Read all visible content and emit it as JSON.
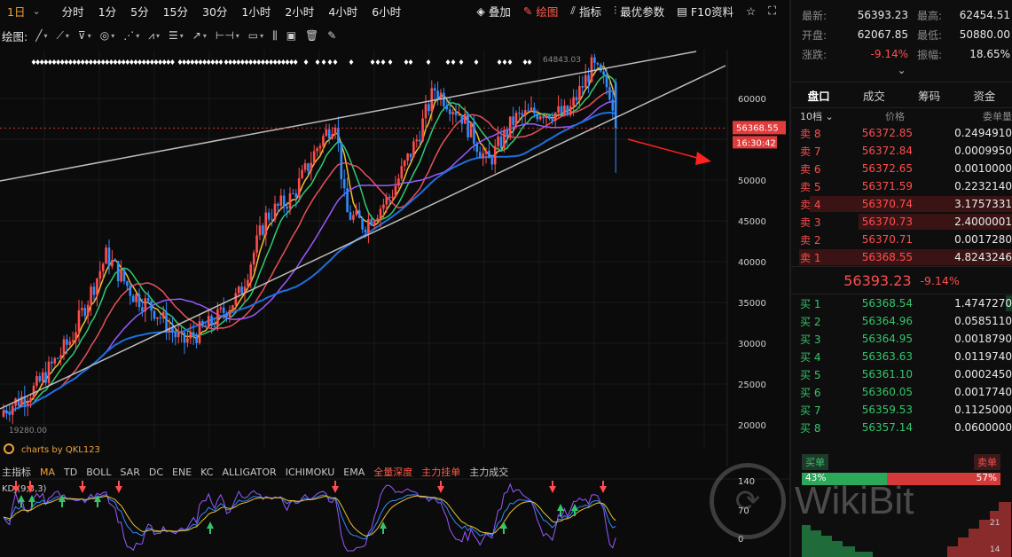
{
  "toolbar": {
    "timeframes": [
      "1日",
      "分时",
      "1分",
      "5分",
      "15分",
      "30分",
      "1小时",
      "2小时",
      "4小时",
      "6小时"
    ],
    "active_timeframe": "1日",
    "tools": [
      {
        "label": "叠加",
        "icon": "layers-icon"
      },
      {
        "label": "绘图",
        "icon": "pencil-icon",
        "active": true
      },
      {
        "label": "指标",
        "icon": "indicator-icon"
      },
      {
        "label": "最优参数",
        "icon": "sliders-icon"
      },
      {
        "label": "F10资料",
        "icon": "f10-icon"
      }
    ]
  },
  "drawbar": {
    "label": "绘图:"
  },
  "chart": {
    "price_ticks": [
      "60000",
      "55000",
      "50000",
      "45000",
      "40000",
      "35000",
      "30000",
      "25000",
      "20000"
    ],
    "current_price_tag": "56368.55",
    "countdown_tag": "16:30:42",
    "high_label": "64843.03",
    "low_label": "19280.00",
    "credit": "charts by QKL123",
    "colors": {
      "up": "#ff4d4d",
      "down": "#2f8cff",
      "ma1": "#f0c030",
      "ma2": "#2ecc71",
      "ma3": "#e8505b",
      "ma4": "#9b59ff",
      "ma5": "#1e6fe0",
      "channel": "#bdbdbd",
      "annotation": "#ff2020"
    }
  },
  "indicator_bar": {
    "items": [
      "主指标",
      "MA",
      "TD",
      "BOLL",
      "SAR",
      "DC",
      "ENE",
      "KC",
      "ALLIGATOR",
      "ICHIMOKU",
      "EMA",
      "全量深度",
      "主力挂单",
      "主力成交"
    ],
    "active": "MA",
    "red_items": [
      "全量深度",
      "主力挂单"
    ]
  },
  "kdj": {
    "label": "KDJ(9,3,3)",
    "ticks": [
      "140",
      "70",
      "0"
    ]
  },
  "stats": {
    "latest_label": "最新:",
    "latest": "56393.23",
    "high_label": "最高:",
    "high": "62454.51",
    "open_label": "开盘:",
    "open": "62067.85",
    "low_label": "最低:",
    "low": "50880.00",
    "change_label": "涨跌:",
    "change": "-9.14%",
    "amp_label": "振幅:",
    "amp": "18.65%"
  },
  "panel_tabs": [
    "盘口",
    "成交",
    "筹码",
    "资金"
  ],
  "orderbook": {
    "levels_label": "10档",
    "price_header": "价格",
    "qty_header": "委单量",
    "asks": [
      {
        "label": "卖 8",
        "price": "56372.85",
        "qty": "0.2494910",
        "depth": 0.0
      },
      {
        "label": "卖 7",
        "price": "56372.84",
        "qty": "0.0009950",
        "depth": 0.0
      },
      {
        "label": "卖 6",
        "price": "56372.65",
        "qty": "0.0010000",
        "depth": 0.0
      },
      {
        "label": "卖 5",
        "price": "56371.59",
        "qty": "0.2232140",
        "depth": 0.0
      },
      {
        "label": "卖 4",
        "price": "56370.74",
        "qty": "3.1757331",
        "depth": 0.95
      },
      {
        "label": "卖 3",
        "price": "56370.73",
        "qty": "2.4000001",
        "depth": 0.72
      },
      {
        "label": "卖 2",
        "price": "56370.71",
        "qty": "0.0017280",
        "depth": 0.0
      },
      {
        "label": "卖 1",
        "price": "56368.55",
        "qty": "4.8243246",
        "depth": 1.0
      }
    ],
    "mid_price": "56393.23",
    "mid_change": "-9.14%",
    "bids": [
      {
        "label": "买 1",
        "price": "56368.54",
        "qty": "1.4747270",
        "depth": 0.03
      },
      {
        "label": "买 2",
        "price": "56364.96",
        "qty": "0.0585110",
        "depth": 0.0
      },
      {
        "label": "买 3",
        "price": "56364.95",
        "qty": "0.0018790",
        "depth": 0.0
      },
      {
        "label": "买 4",
        "price": "56363.63",
        "qty": "0.0119740",
        "depth": 0.0
      },
      {
        "label": "买 5",
        "price": "56361.10",
        "qty": "0.0002450",
        "depth": 0.0
      },
      {
        "label": "买 6",
        "price": "56360.05",
        "qty": "0.0017740",
        "depth": 0.0
      },
      {
        "label": "买 7",
        "price": "56359.53",
        "qty": "0.1125000",
        "depth": 0.0
      },
      {
        "label": "买 8",
        "price": "56357.14",
        "qty": "0.0600000",
        "depth": 0.0
      }
    ]
  },
  "ratio": {
    "buy_label": "买单",
    "sell_label": "卖单",
    "buy_pct": "43%",
    "sell_pct": "57%",
    "buy_fraction": 0.43
  },
  "depth_ticks": [
    "21",
    "14"
  ],
  "watermark": "WikiBit"
}
